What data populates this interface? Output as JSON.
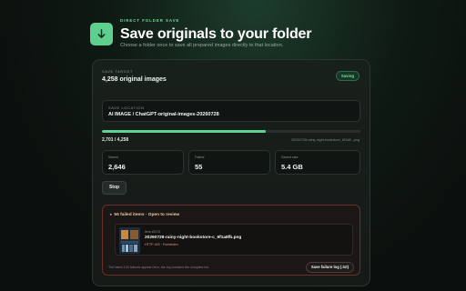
{
  "colors": {
    "accent": "#5fcf90",
    "progress": "#5fd394",
    "danger_border": "#6a3028",
    "badge_text": "#6fe0a0"
  },
  "header": {
    "icon": "download-arrow-icon",
    "eyebrow": "DIRECT FOLDER SAVE",
    "title": "Save originals to your folder",
    "subtitle": "Choose a folder once to save all prepared images directly to that location."
  },
  "target": {
    "label": "SAVE TARGET",
    "value": "4,258 original images",
    "status": "Saving"
  },
  "location": {
    "label": "SAVE LOCATION",
    "value": "AI IMAGE / ChatGPT-original-images-20260728"
  },
  "progress": {
    "fraction": 0.634,
    "count": "2,701 / 4,258",
    "current_file": "20260728-rainy-night-bookstore_8f1d8...png"
  },
  "stats": [
    {
      "label": "Saved",
      "value": "2,646"
    },
    {
      "label": "Failed",
      "value": "55"
    },
    {
      "label": "Saved size",
      "value": "5.4 GB"
    }
  ],
  "stop_label": "Stop",
  "failures": {
    "toggle": "55 failed items · Open to review",
    "item": {
      "meta": "Item #0721",
      "name": "20260728-rainy-night-bookstore-c_9f1a8fb.png",
      "error": "HTTP 403 · Forbidden"
    },
    "note": "The latest 100 failures appear here; the log contains the complete list.",
    "save_log_label": "Save failure log (.txt)"
  }
}
